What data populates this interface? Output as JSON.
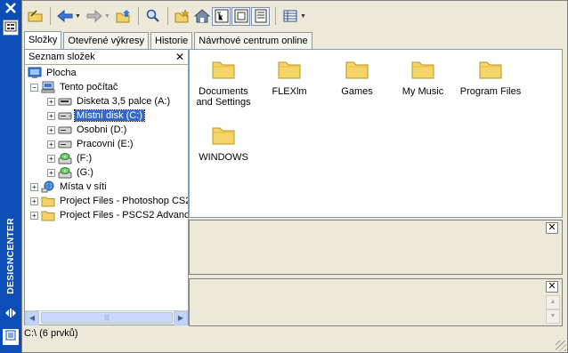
{
  "palette": "designcenter",
  "side": {
    "title": "DESIGNCENTER",
    "icons": [
      "close-icon",
      "properties-icon",
      "auto-hide-icon",
      "menu-icon"
    ]
  },
  "toolbar": {
    "icons": [
      "load-icon",
      "back-icon",
      "forward-icon",
      "up-icon",
      "search-icon",
      "favorites-icon",
      "home-icon",
      "tree-toggle-icon",
      "preview-icon",
      "description-icon",
      "views-icon"
    ]
  },
  "tabs": [
    {
      "label": "Složky",
      "active": true
    },
    {
      "label": "Otevřené výkresy",
      "active": false
    },
    {
      "label": "Historie",
      "active": false
    },
    {
      "label": "Návrhové centrum online",
      "active": false
    }
  ],
  "tree": {
    "header": "Seznam složek",
    "items": [
      {
        "label": "Plocha",
        "expander": "",
        "icon": "desktop-icon"
      },
      {
        "label": "Tento počítač",
        "expander": "−",
        "icon": "computer-icon"
      },
      {
        "label": "Disketa 3,5 palce (A:)",
        "expander": "+",
        "icon": "floppy-drive-icon"
      },
      {
        "label": "Místní disk (C:)",
        "expander": "+",
        "icon": "disk-drive-icon",
        "selected": true
      },
      {
        "label": "Osobni (D:)",
        "expander": "+",
        "icon": "disk-drive-icon"
      },
      {
        "label": "Pracovni (E:)",
        "expander": "+",
        "icon": "disk-drive-icon"
      },
      {
        "label": " (F:)",
        "expander": "+",
        "icon": "cd-drive-icon"
      },
      {
        "label": " (G:)",
        "expander": "+",
        "icon": "cd-drive-icon"
      },
      {
        "label": "Místa v síti",
        "expander": "+",
        "icon": "network-icon"
      },
      {
        "label": "Project Files - Photoshop CS2",
        "expander": "+",
        "icon": "folder-icon"
      },
      {
        "label": "Project Files - PSCS2 Advanc",
        "expander": "+",
        "icon": "folder-icon"
      }
    ]
  },
  "content": {
    "items": [
      {
        "label": "Documents and Settings"
      },
      {
        "label": "FLEXlm"
      },
      {
        "label": "Games"
      },
      {
        "label": "My Music"
      },
      {
        "label": "Program Files"
      },
      {
        "label": "WINDOWS"
      }
    ]
  },
  "status": {
    "text": "C:\\ (6 prvků)"
  }
}
